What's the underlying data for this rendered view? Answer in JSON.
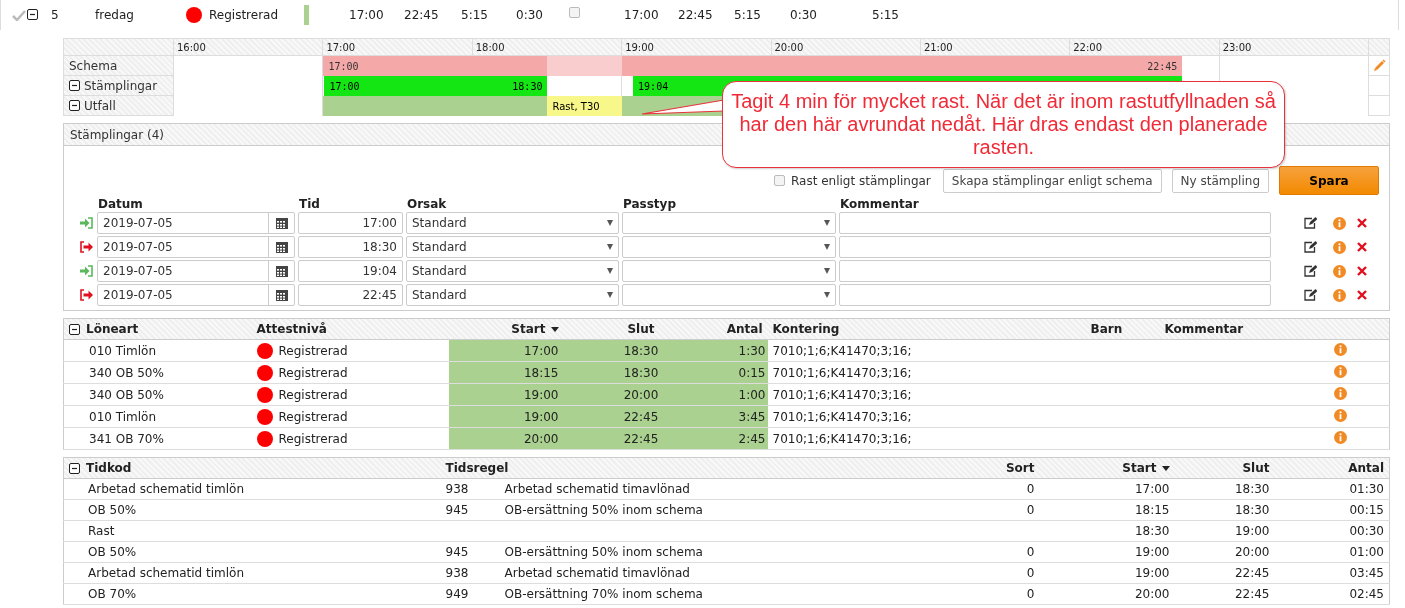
{
  "day_row": {
    "expanded": true,
    "number": "5",
    "weekday": "fredag",
    "status": {
      "label": "Registrerad",
      "color": "#ff0000"
    },
    "values": [
      "17:00",
      "22:45",
      "5:15",
      "0:30"
    ],
    "flag_checked": false,
    "values_2": [
      "17:00",
      "22:45",
      "5:15",
      "0:30",
      "5:15"
    ]
  },
  "timeline": {
    "hours": [
      "16:00",
      "17:00",
      "18:00",
      "19:00",
      "20:00",
      "21:00",
      "22:00",
      "23:00"
    ],
    "rows": [
      {
        "kind": "plain",
        "label": "Schema",
        "segments": [
          {
            "kind": "schedule",
            "label_start": "17:00"
          },
          {
            "kind": "schedule_break"
          },
          {
            "kind": "schedule",
            "label_end": "22:45"
          }
        ]
      },
      {
        "kind": "group",
        "expanded": true,
        "label": "Stämplingar",
        "segments": [
          {
            "kind": "punch",
            "label_start": "17:00",
            "label_end": "18:30"
          },
          {
            "kind": "punch",
            "label_start": "19:04"
          }
        ]
      },
      {
        "kind": "group",
        "expanded": true,
        "label": "Utfall",
        "segments": [
          {
            "kind": "result"
          },
          {
            "kind": "break_result",
            "label_start": "Rast, T30"
          },
          {
            "kind": "result"
          }
        ]
      }
    ]
  },
  "callout": {
    "text": "Tagit 4 min för mycket rast. När det är inom rastutfyllnaden så har den här avrundat nedåt. Här dras endast den planerade rasten."
  },
  "punches": {
    "title": "Stämplingar (4)",
    "break_checkbox": {
      "label": "Rast enligt stämplingar",
      "checked": false
    },
    "buttons": [
      {
        "label": "Skapa stämplingar enligt schema",
        "kind": "secondary"
      },
      {
        "label": "Ny stämpling",
        "kind": "secondary"
      },
      {
        "label": "Spara",
        "kind": "primary"
      }
    ],
    "columns": [
      "Datum",
      "Tid",
      "Orsak",
      "Passtyp",
      "Kommentar"
    ],
    "rows": [
      {
        "kind": "in",
        "date": "2019-07-05",
        "time": "17:00",
        "reason": "Standard"
      },
      {
        "kind": "out",
        "date": "2019-07-05",
        "time": "18:30",
        "reason": "Standard"
      },
      {
        "kind": "in",
        "date": "2019-07-05",
        "time": "19:04",
        "reason": "Standard"
      },
      {
        "kind": "out",
        "date": "2019-07-05",
        "time": "22:45",
        "reason": "Standard"
      }
    ]
  },
  "wage_table": {
    "expanded": true,
    "columns": [
      "Löneart",
      "Attestnivå",
      "Start",
      "Slut",
      "Antal",
      "Kontering",
      "Barn",
      "Kommentar"
    ],
    "rows": [
      {
        "type": "010 Timlön",
        "status": {
          "label": "Registrerad",
          "color": "#ff0000"
        },
        "start": "17:00",
        "end": "18:30",
        "amount": "1:30",
        "account": "7010;1;6;K41470;3;16;"
      },
      {
        "type": "340 OB 50%",
        "status": {
          "label": "Registrerad",
          "color": "#ff0000"
        },
        "start": "18:15",
        "end": "18:30",
        "amount": "0:15",
        "account": "7010;1;6;K41470;3;16;"
      },
      {
        "type": "340 OB 50%",
        "status": {
          "label": "Registrerad",
          "color": "#ff0000"
        },
        "start": "19:00",
        "end": "20:00",
        "amount": "1:00",
        "account": "7010;1;6;K41470;3;16;"
      },
      {
        "type": "010 Timlön",
        "status": {
          "label": "Registrerad",
          "color": "#ff0000"
        },
        "start": "19:00",
        "end": "22:45",
        "amount": "3:45",
        "account": "7010;1;6;K41470;3;16;"
      },
      {
        "type": "341 OB 70%",
        "status": {
          "label": "Registrerad",
          "color": "#ff0000"
        },
        "start": "20:00",
        "end": "22:45",
        "amount": "2:45",
        "account": "7010;1;6;K41470;3;16;"
      }
    ]
  },
  "timecode_table": {
    "expanded": true,
    "columns": [
      "Tidkod",
      "Tidsregel",
      "Sort",
      "Start",
      "Slut",
      "Antal"
    ],
    "rows": [
      {
        "code": "Arbetad schematid timlön",
        "rule_no": "938",
        "rule": "Arbetad schematid timavlönad",
        "sort": "0",
        "start": "17:00",
        "end": "18:30",
        "amount": "01:30"
      },
      {
        "code": "OB 50%",
        "rule_no": "945",
        "rule": "OB-ersättning 50% inom schema",
        "sort": "0",
        "start": "18:15",
        "end": "18:30",
        "amount": "00:15"
      },
      {
        "code": "Rast",
        "start": "18:30",
        "end": "19:00",
        "amount": "00:30"
      },
      {
        "code": "OB 50%",
        "rule_no": "945",
        "rule": "OB-ersättning 50% inom schema",
        "sort": "0",
        "start": "19:00",
        "end": "20:00",
        "amount": "01:00"
      },
      {
        "code": "Arbetad schematid timlön",
        "rule_no": "938",
        "rule": "Arbetad schematid timavlönad",
        "sort": "0",
        "start": "19:00",
        "end": "22:45",
        "amount": "03:45"
      },
      {
        "code": "OB 70%",
        "rule_no": "949",
        "rule": "OB-ersättning 70% inom schema",
        "sort": "0",
        "start": "20:00",
        "end": "22:45",
        "amount": "02:45"
      }
    ]
  }
}
